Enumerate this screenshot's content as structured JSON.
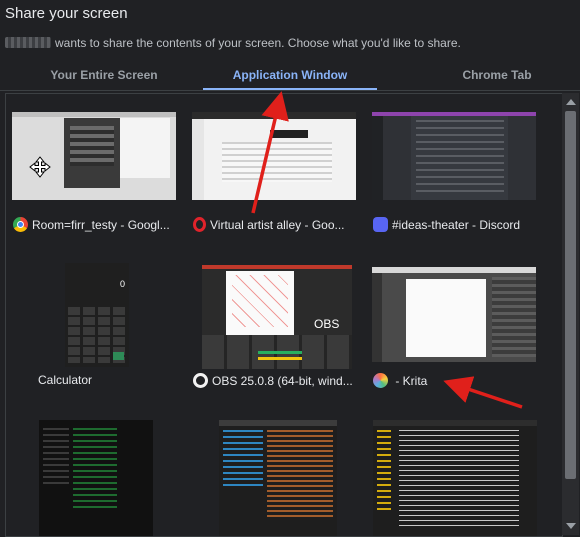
{
  "dialog": {
    "title": "Share your screen",
    "subtitle": "wants to share the contents of your screen. Choose what you'd like to share."
  },
  "tabs": [
    {
      "label": "Your Entire Screen",
      "active": false
    },
    {
      "label": "Application Window",
      "active": true
    },
    {
      "label": "Chrome Tab",
      "active": false
    }
  ],
  "windows": [
    {
      "label": "Room=firr_testy - Googl...",
      "icon": "chrome-icon"
    },
    {
      "label": "Virtual artist alley - Goo...",
      "icon": "opera-icon"
    },
    {
      "label": "#ideas-theater - Discord",
      "icon": "discord-icon"
    },
    {
      "label": "Calculator",
      "icon": ""
    },
    {
      "label": "OBS 25.0.8 (64-bit, wind...",
      "icon": "obs-icon"
    },
    {
      "label": " - Krita",
      "icon": "krita-icon"
    }
  ],
  "thumb_text": {
    "calc_display": "0",
    "obs_overlay": "OBS"
  },
  "colors": {
    "accent": "#8ab4f8",
    "background": "#202124",
    "annotation_arrow": "#e0201b"
  }
}
